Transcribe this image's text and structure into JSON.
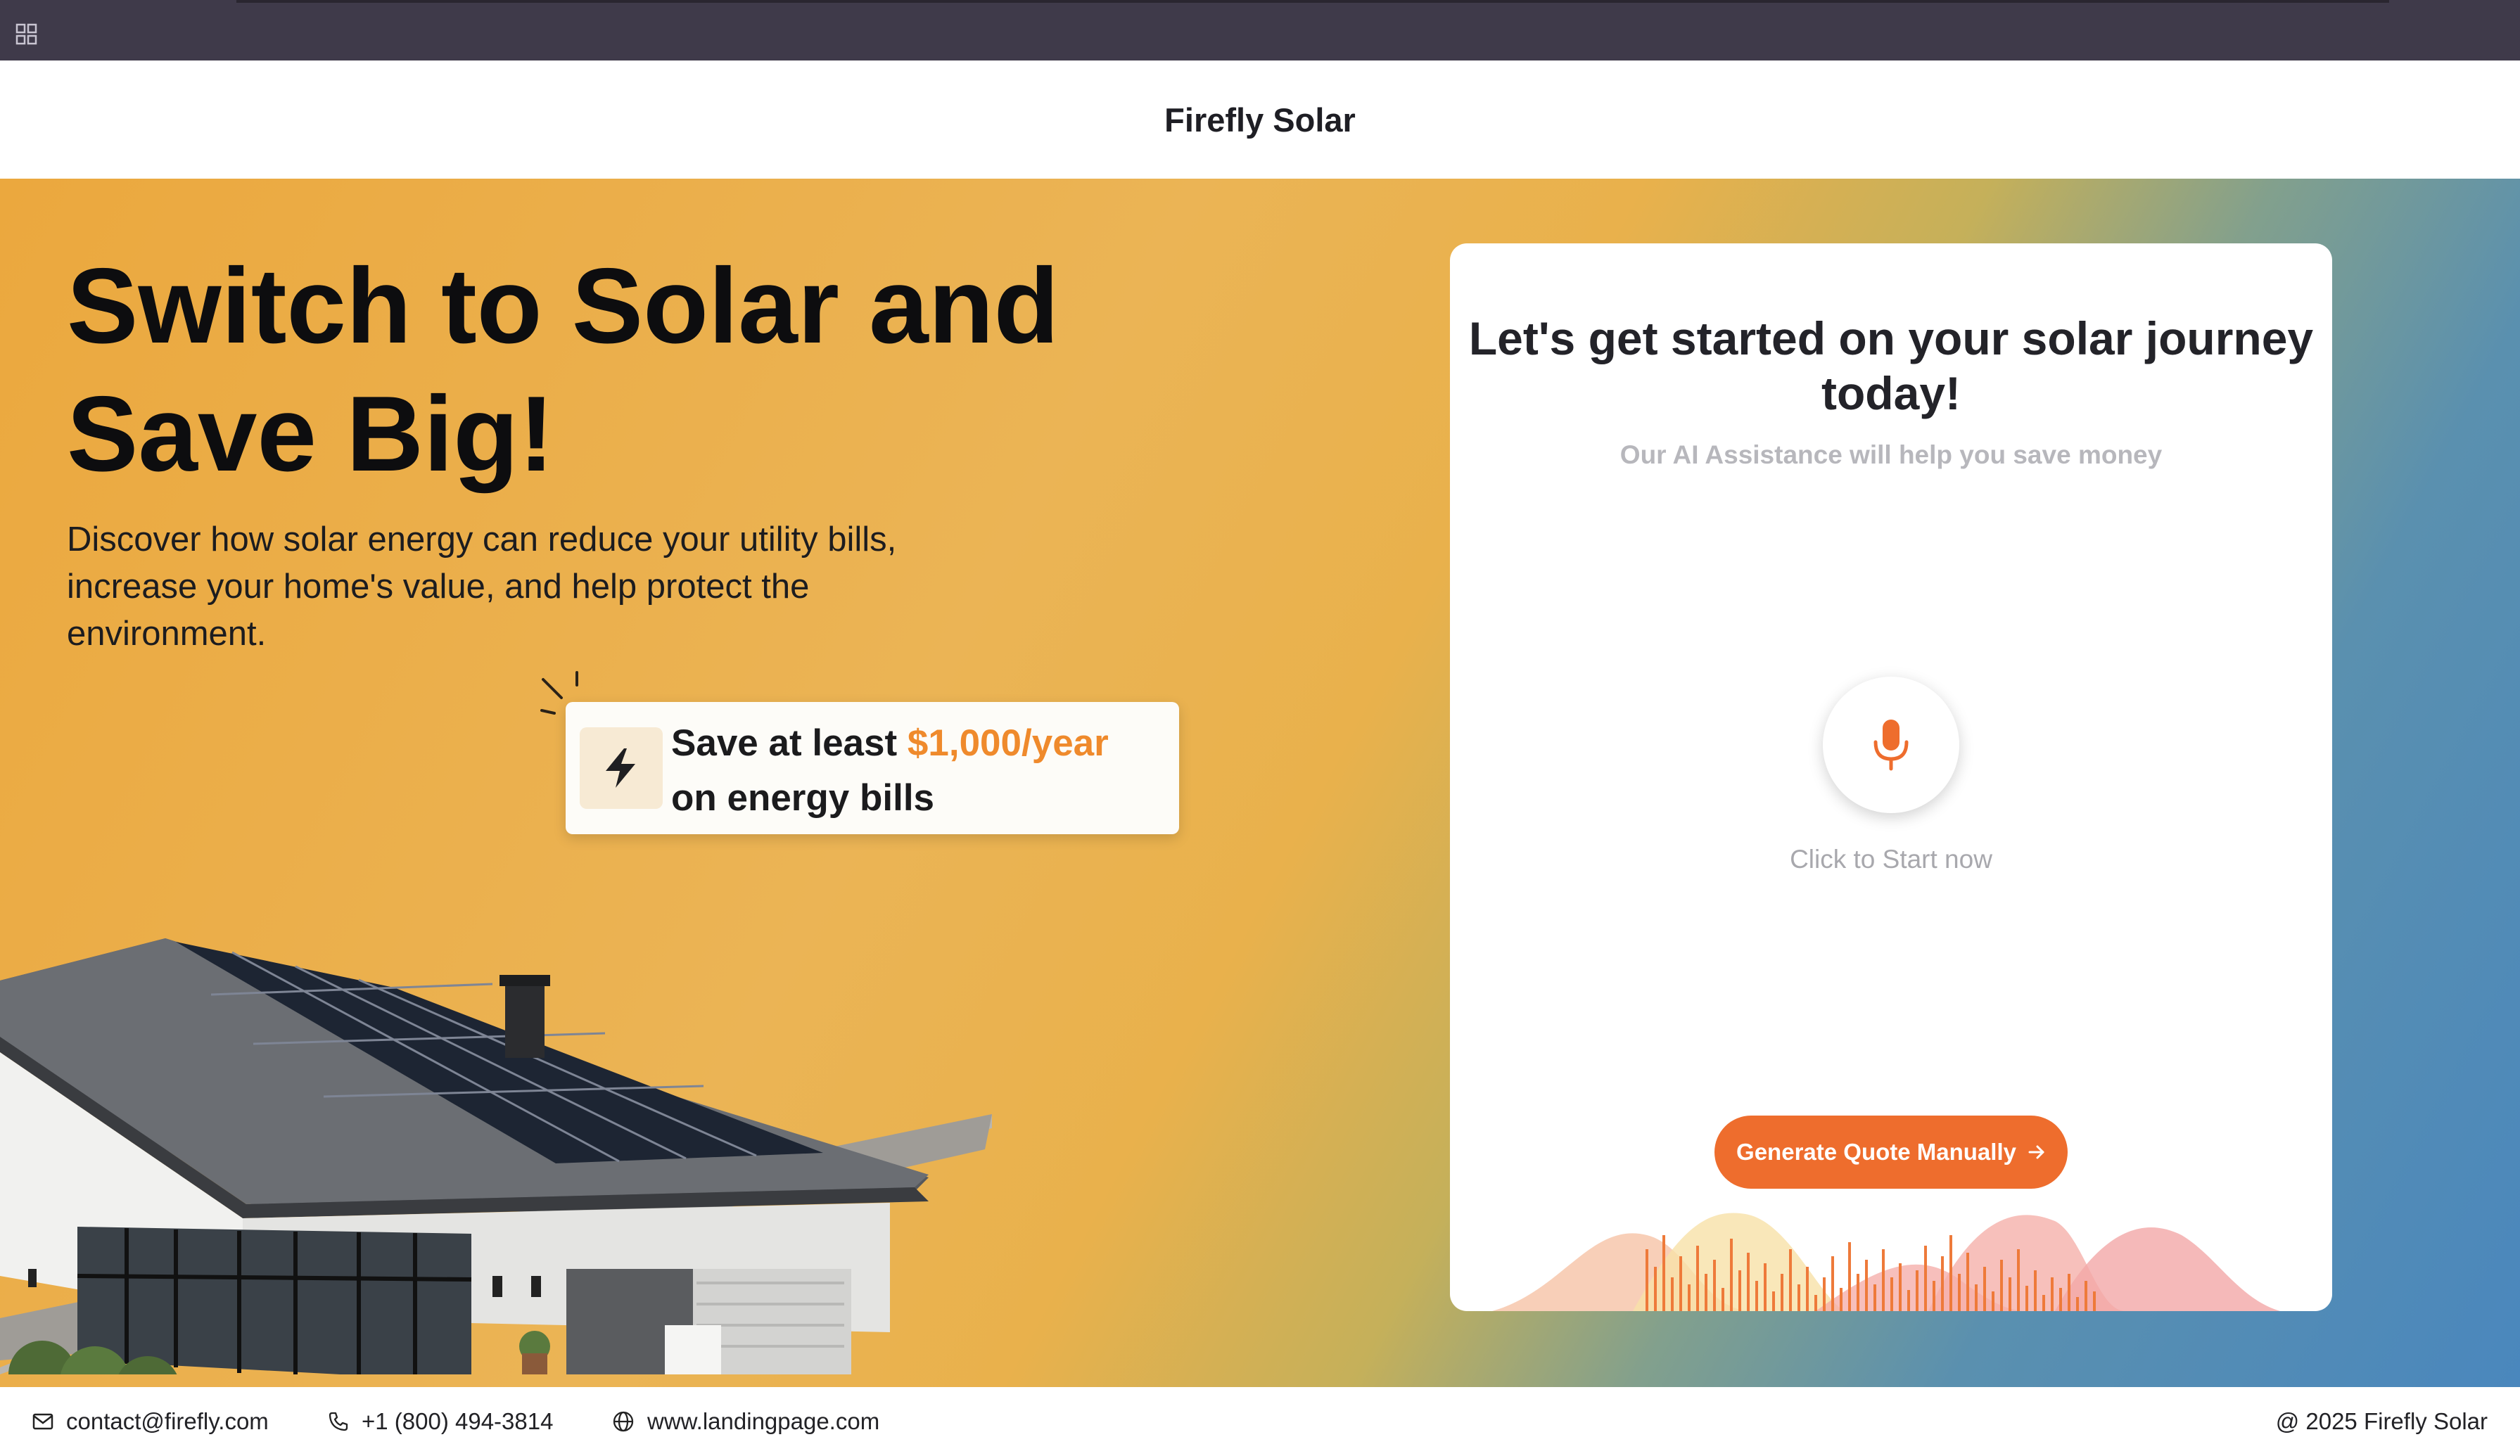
{
  "topbar": {
    "icon": "grid-icon"
  },
  "header": {
    "brand": "Firefly Solar"
  },
  "hero": {
    "title": "Switch to Solar and Save Big!",
    "subtitle": "Discover how solar energy can reduce your utility bills, increase your home's value, and help protect the environment."
  },
  "callout": {
    "icon": "lightning-bolt-icon",
    "text_prefix": "Save at least ",
    "highlight": "$1,000/year",
    "text_suffix": "on energy bills",
    "highlight_color": "#ef8a2c"
  },
  "card": {
    "title": "Let's get started on your solar journey today!",
    "subtitle": "Our AI Assistance will help you save money",
    "mic_icon": "microphone-icon",
    "mic_label": "Click to Start now",
    "quote_button": "Generate Quote Manually",
    "accent": "#ee6d2d"
  },
  "footer": {
    "email": "contact@firefly.com",
    "phone": "+1 (800) 494-3814",
    "website": "www.landingpage.com",
    "copyright": "@ 2025 Firefly Solar"
  }
}
